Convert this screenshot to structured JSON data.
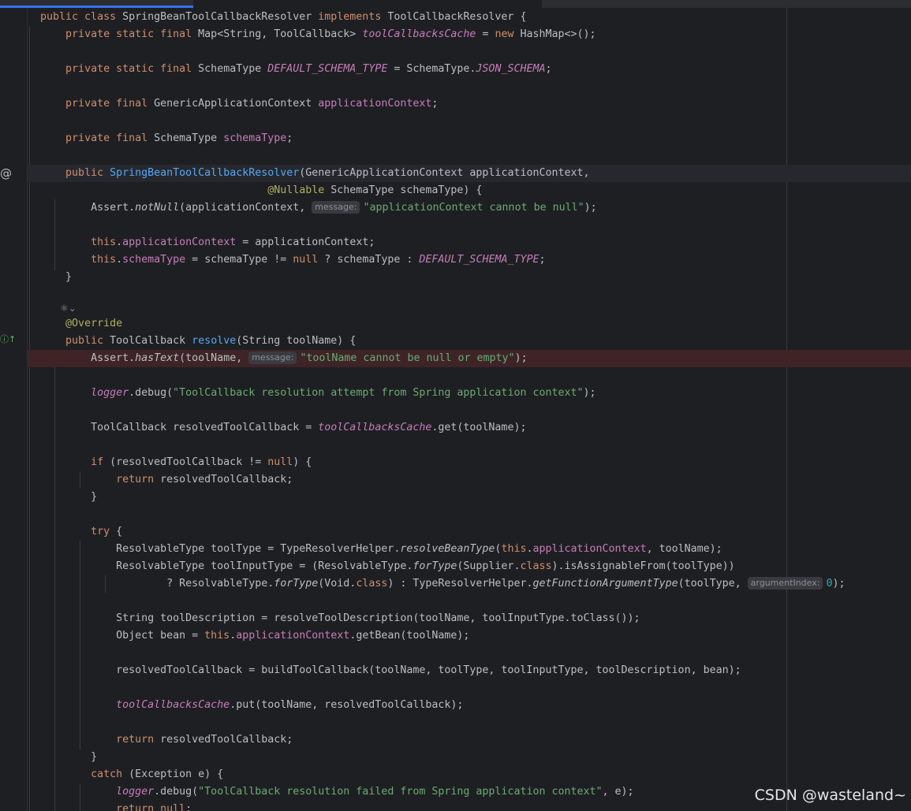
{
  "editor": {
    "language": "Java",
    "gutter_icons": {
      "implements": "@",
      "override": "override-icon",
      "fold": "code-vision-icon"
    },
    "colors": {
      "background": "#1e1f22",
      "keyword": "#cf8e6d",
      "field": "#c77dbb",
      "string": "#6aab73",
      "number": "#2aacb8",
      "declaration": "#56a8f5",
      "annotation": "#b3ae60",
      "error_line": "#3e2427",
      "tab_indicator": "#3574f0"
    },
    "lines": {
      "l1": {
        "p1": "public class ",
        "p2": "SpringBeanToolCallbackResolver ",
        "p3": "implements ",
        "p4": "ToolCallbackResolver {"
      },
      "l2": {
        "p1": "private static final ",
        "p2": "Map<String, ToolCallback> ",
        "p3": "toolCallbacksCache",
        "p4": " = ",
        "p5": "new ",
        "p6": "HashMap<>();"
      },
      "l3": {
        "p1": "private static final ",
        "p2": "SchemaType ",
        "p3": "DEFAULT_SCHEMA_TYPE",
        "p4": " = SchemaType.",
        "p5": "JSON_SCHEMA",
        "p6": ";"
      },
      "l4": {
        "p1": "private final ",
        "p2": "GenericApplicationContext ",
        "p3": "applicationContext",
        "p4": ";"
      },
      "l5": {
        "p1": "private final ",
        "p2": "SchemaType ",
        "p3": "schemaType",
        "p4": ";"
      },
      "l6": {
        "p1": "public ",
        "p2": "SpringBeanToolCallbackResolver",
        "p3": "(GenericApplicationContext applicationContext,"
      },
      "l7": {
        "p1": "@Nullable",
        "p2": " SchemaType schemaType) {"
      },
      "l8": {
        "p1": "Assert.",
        "p2": "notNull",
        "p3": "(applicationContext, ",
        "hint": "message:",
        "p4": "\"applicationContext cannot be null\"",
        "p5": ");"
      },
      "l9": {
        "p1": "this",
        "p2": ".",
        "p3": "applicationContext",
        "p4": " = applicationContext;"
      },
      "l10": {
        "p1": "this",
        "p2": ".",
        "p3": "schemaType",
        "p4": " = schemaType != ",
        "p5": "null",
        "p6": " ? schemaType : ",
        "p7": "DEFAULT_SCHEMA_TYPE",
        "p8": ";"
      },
      "l11": {
        "p1": "}"
      },
      "l12": {
        "p1": "@Override"
      },
      "l13": {
        "p1": "public ",
        "p2": "ToolCallback ",
        "p3": "resolve",
        "p4": "(String toolName) {"
      },
      "l14": {
        "p1": "Assert.",
        "p2": "hasText",
        "p3": "(toolName, ",
        "hint": "message:",
        "p4": "\"toolName cannot be null or empty\"",
        "p5": ");"
      },
      "l15": {
        "p1": "logger",
        "p2": ".debug(",
        "p3": "\"ToolCallback resolution attempt from Spring application context\"",
        "p4": ");"
      },
      "l16": {
        "p1": "ToolCallback resolvedToolCallback = ",
        "p2": "toolCallbacksCache",
        "p3": ".get(toolName);"
      },
      "l17": {
        "p1": "if",
        "p2": " (resolvedToolCallback != ",
        "p3": "null",
        "p4": ") {"
      },
      "l18": {
        "p1": "return",
        "p2": " resolvedToolCallback;"
      },
      "l19": {
        "p1": "}"
      },
      "l20": {
        "p1": "try",
        "p2": " {"
      },
      "l21": {
        "p1": "ResolvableType toolType = TypeResolverHelper.",
        "p2": "resolveBeanType",
        "p3": "(",
        "p4": "this",
        "p5": ".",
        "p6": "applicationContext",
        "p7": ", toolName);"
      },
      "l22": {
        "p1": "ResolvableType toolInputType = (ResolvableType.",
        "p2": "forType",
        "p3": "(Supplier.",
        "p4": "class",
        "p5": ").isAssignableFrom(toolType))"
      },
      "l23": {
        "p1": "? ResolvableType.",
        "p2": "forType",
        "p3": "(Void.",
        "p4": "class",
        "p5": ") : TypeResolverHelper.",
        "p6": "getFunctionArgumentType",
        "p7": "(toolType, ",
        "hint": "argumentIndex:",
        "p8": "0",
        "p9": ");"
      },
      "l24": {
        "p1": "String toolDescription = resolveToolDescription(toolName, toolInputType.toClass());"
      },
      "l25": {
        "p1": "Object bean = ",
        "p2": "this",
        "p3": ".",
        "p4": "applicationContext",
        "p5": ".getBean(toolName);"
      },
      "l26": {
        "p1": "resolvedToolCallback = buildToolCallback(toolName, toolType, toolInputType, toolDescription, bean);"
      },
      "l27": {
        "p1": "toolCallbacksCache",
        "p2": ".put(toolName, resolvedToolCallback);"
      },
      "l28": {
        "p1": "return",
        "p2": " resolvedToolCallback;"
      },
      "l29": {
        "p1": "}"
      },
      "l30": {
        "p1": "catch",
        "p2": " (Exception e) {"
      },
      "l31": {
        "p1": "logger",
        "p2": ".debug(",
        "p3": "\"ToolCallback resolution failed from Spring application context\"",
        "p4": ", e);"
      },
      "l32": {
        "p1": "return",
        "p2": " ",
        "p3": "null",
        "p4": ";"
      }
    }
  },
  "watermark": "CSDN @wasteland~"
}
